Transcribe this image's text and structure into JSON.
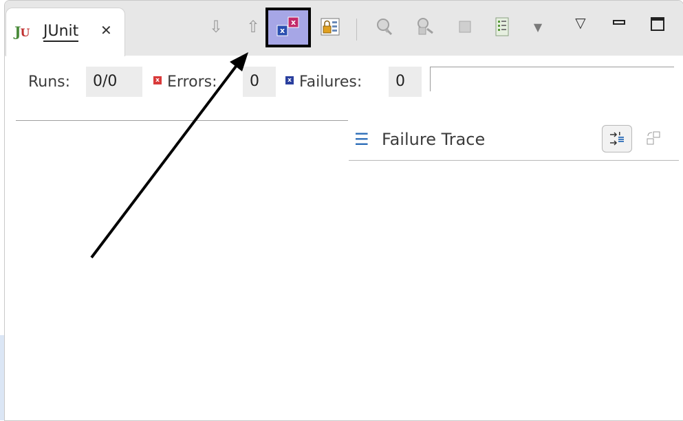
{
  "tab": {
    "icon": "junit-icon",
    "title": "JUnit",
    "close_icon": "close-tab-icon"
  },
  "toolbar": {
    "items": [
      {
        "name": "next-failure-icon",
        "glyph": "⇩"
      },
      {
        "name": "previous-failure-icon",
        "glyph": "⇧"
      },
      {
        "name": "show-failures-only-icon",
        "selected": true
      },
      {
        "name": "scroll-lock-icon"
      },
      {
        "name": "rerun-test-icon"
      },
      {
        "name": "rerun-failed-first-icon"
      },
      {
        "name": "stop-icon"
      },
      {
        "name": "test-run-history-icon"
      },
      {
        "name": "history-dropdown-icon",
        "glyph": "▾"
      },
      {
        "name": "view-menu-icon",
        "glyph": "▽"
      },
      {
        "name": "minimize-icon",
        "glyph": "▭"
      },
      {
        "name": "maximize-icon",
        "glyph": "□"
      }
    ]
  },
  "stats": {
    "runs_label": "Runs:",
    "runs_value": "0/0",
    "errors_label": "Errors:",
    "errors_value": "0",
    "failures_label": "Failures:",
    "failures_value": "0"
  },
  "trace": {
    "title": "Failure Trace",
    "icon": "stack-trace-icon"
  },
  "colors": {
    "selected_bg": "#a6a6e6",
    "error_red": "#d93a3a",
    "failure_blue": "#2a3f9e",
    "toolbar_bg": "#e7e7e7"
  }
}
